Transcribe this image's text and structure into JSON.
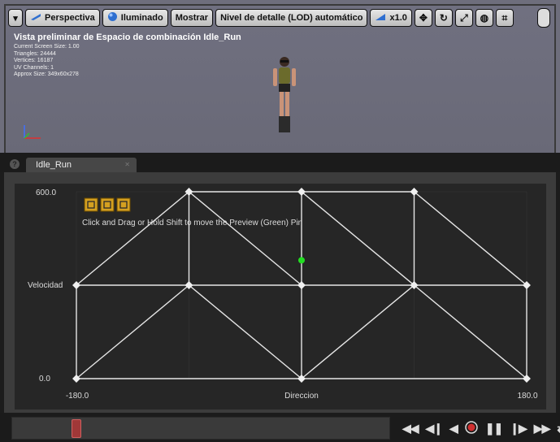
{
  "toolbar": {
    "caret_icon": "caret-down-icon",
    "perspective_label": "Perspectiva",
    "lit_label": "Iluminado",
    "show_label": "Mostrar",
    "lod_label": "Nivel de detalle (LOD) automático",
    "speed_label": "x1.0",
    "icons": [
      "camera-icon",
      "move-icon",
      "rotate-icon",
      "scale-icon",
      "globe-icon",
      "snap-icon"
    ]
  },
  "viewport": {
    "title": "Vista preliminar de Espacio de combinación  Idle_Run",
    "stats": [
      "Current Screen Size: 1.00",
      "Triangles: 24444",
      "Vertices: 16187",
      "UV Channels: 1",
      "Approx Size: 349x60x278"
    ]
  },
  "tab": {
    "label": "Idle_Run"
  },
  "graph": {
    "hint": "Click and Drag or Hold Shift to move the Preview (Green) Pin",
    "y_axis_label": "Velocidad",
    "x_axis_label": "Direccion",
    "y_max_label": "600.0",
    "y_min_label": "0.0",
    "x_min_label": "-180.0",
    "x_max_label": "180.0",
    "tool_icons": [
      "grid-tool-icon",
      "triangle-tool-icon",
      "fit-tool-icon"
    ],
    "colors": {
      "line": "#e6e6e6",
      "sample": "#f0f0f0",
      "preview_pin": "#22dd22",
      "tool": "#d4a020"
    },
    "x_range": [
      -180,
      180
    ],
    "y_range": [
      0,
      600
    ],
    "samples": [
      {
        "x": -180,
        "y": 0
      },
      {
        "x": 0,
        "y": 0
      },
      {
        "x": 180,
        "y": 0
      },
      {
        "x": -180,
        "y": 300
      },
      {
        "x": -90,
        "y": 300
      },
      {
        "x": 0,
        "y": 300
      },
      {
        "x": 90,
        "y": 300
      },
      {
        "x": 180,
        "y": 300
      },
      {
        "x": -90,
        "y": 600
      },
      {
        "x": 0,
        "y": 600
      },
      {
        "x": 90,
        "y": 600
      }
    ],
    "edges": [
      [
        0,
        1
      ],
      [
        1,
        2
      ],
      [
        3,
        4
      ],
      [
        4,
        5
      ],
      [
        5,
        6
      ],
      [
        6,
        7
      ],
      [
        8,
        9
      ],
      [
        9,
        10
      ],
      [
        0,
        3
      ],
      [
        0,
        4
      ],
      [
        1,
        4
      ],
      [
        1,
        5
      ],
      [
        1,
        6
      ],
      [
        2,
        6
      ],
      [
        2,
        7
      ],
      [
        3,
        8
      ],
      [
        4,
        8
      ],
      [
        5,
        9
      ],
      [
        6,
        10
      ],
      [
        7,
        10
      ],
      [
        5,
        8
      ],
      [
        6,
        9
      ]
    ],
    "preview": {
      "x": 0,
      "y": 380
    }
  },
  "timeline": {
    "controls": [
      "skip-start-icon",
      "step-back-icon",
      "play-reverse-icon",
      "record-icon",
      "pause-icon",
      "step-forward-icon",
      "skip-end-icon",
      "loop-icon"
    ]
  }
}
